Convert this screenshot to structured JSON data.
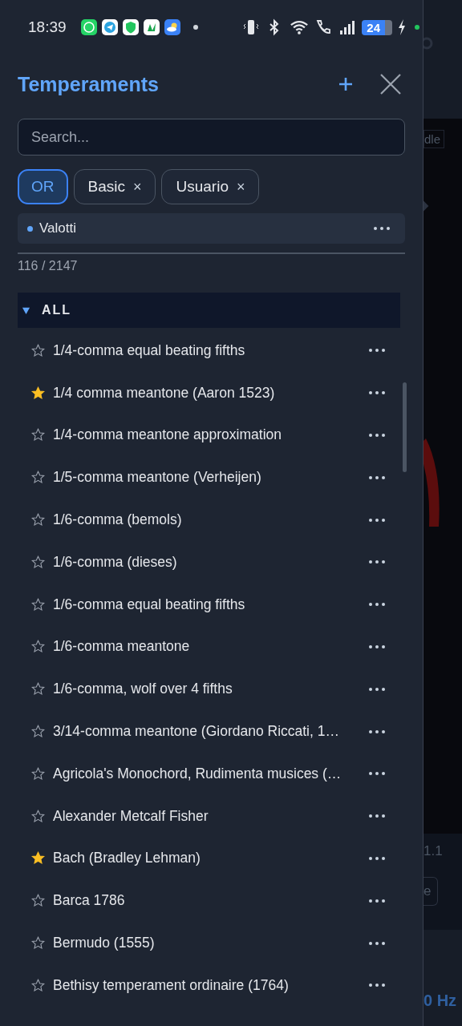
{
  "status_bar": {
    "time": "18:39",
    "battery": "24"
  },
  "drawer": {
    "title": "Temperaments",
    "search": {
      "placeholder": "Search..."
    },
    "chips": [
      {
        "label": "OR",
        "kind": "operator"
      },
      {
        "label": "Basic",
        "kind": "tag",
        "remove": "×"
      },
      {
        "label": "Usuario",
        "kind": "tag",
        "remove": "×"
      }
    ],
    "selected_item": {
      "label": "Valotti"
    },
    "count": "116 / 2147",
    "group": {
      "label": "ALL",
      "expanded": true
    },
    "items": [
      {
        "name": "1/4-comma equal beating fifths",
        "favorite": false
      },
      {
        "name": "1/4 comma meantone (Aaron 1523)",
        "favorite": true
      },
      {
        "name": "1/4-comma meantone approximation",
        "favorite": false
      },
      {
        "name": "1/5-comma meantone (Verheijen)",
        "favorite": false
      },
      {
        "name": "1/6-comma (bemols)",
        "favorite": false
      },
      {
        "name": "1/6-comma (dieses)",
        "favorite": false
      },
      {
        "name": "1/6-comma equal beating fifths",
        "favorite": false
      },
      {
        "name": "1/6-comma meantone",
        "favorite": false
      },
      {
        "name": "1/6-comma, wolf over 4 fifths",
        "favorite": false
      },
      {
        "name": "3/14-comma meantone (Giordano Riccati, 1…",
        "favorite": false
      },
      {
        "name": "Agricola's Monochord, Rudimenta musices (…",
        "favorite": false
      },
      {
        "name": "Alexander Metcalf Fisher",
        "favorite": false
      },
      {
        "name": "Bach (Bradley Lehman)",
        "favorite": true
      },
      {
        "name": "Barca 1786",
        "favorite": false
      },
      {
        "name": "Bermudo (1555)",
        "favorite": false
      },
      {
        "name": "Bethisy temperament ordinaire (1764)",
        "favorite": false
      }
    ]
  },
  "background": {
    "button_fragment": "dle",
    "value_fragment": "1.1",
    "button_fragment_2": "e",
    "frequency_fragment": "0 Hz"
  }
}
